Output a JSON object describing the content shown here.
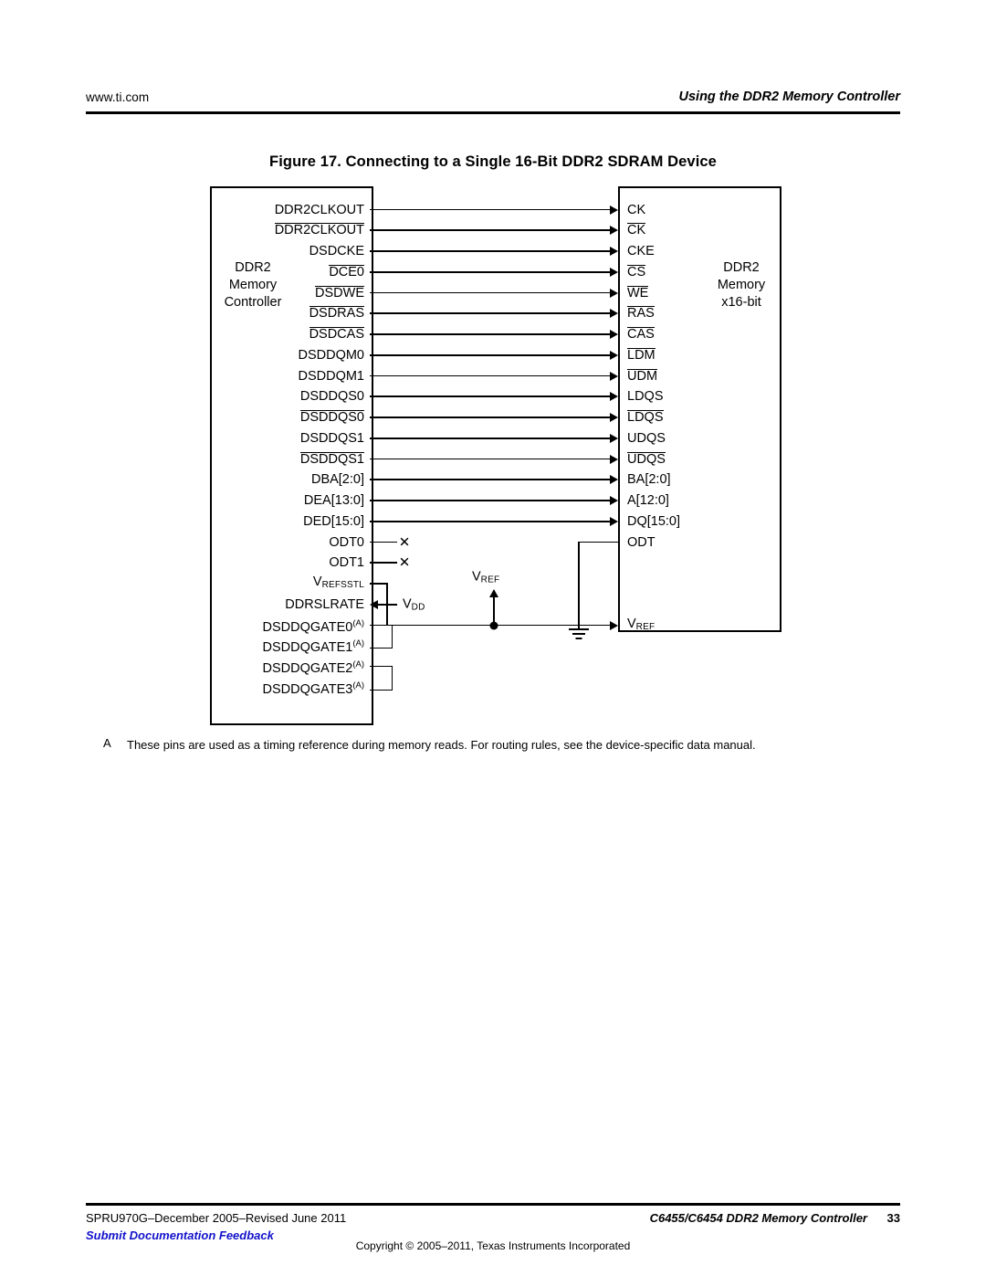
{
  "header": {
    "url": "www.ti.com",
    "section_title": "Using the DDR2 Memory Controller"
  },
  "figure": {
    "caption": "Figure 17. Connecting to a Single 16-Bit DDR2 SDRAM Device",
    "left_block_label": "DDR2\nMemory\nController",
    "left_block_lines": [
      "DDR2",
      "Memory",
      "Controller"
    ],
    "right_block_lines": [
      "DDR2",
      "Memory",
      "x16-bit"
    ],
    "signals": [
      {
        "left": "DDR2CLKOUT",
        "left_overline": false,
        "right": "CK",
        "right_overline": false,
        "arrow": "right"
      },
      {
        "left": "DDR2CLKOUT",
        "left_overline": true,
        "right": "CK",
        "right_overline": true,
        "arrow": "right"
      },
      {
        "left": "DSDCKE",
        "left_overline": false,
        "right": "CKE",
        "right_overline": false,
        "arrow": "right"
      },
      {
        "left": "DCE0",
        "left_overline": true,
        "right": "CS",
        "right_overline": true,
        "arrow": "right"
      },
      {
        "left": "DSDWE",
        "left_overline": true,
        "right": "WE",
        "right_overline": true,
        "arrow": "right"
      },
      {
        "left": "DSDRAS",
        "left_overline": true,
        "right": "RAS",
        "right_overline": true,
        "arrow": "right"
      },
      {
        "left": "DSDCAS",
        "left_overline": true,
        "right": "CAS",
        "right_overline": true,
        "arrow": "right"
      },
      {
        "left": "DSDDQM0",
        "left_overline": false,
        "right": "LDM",
        "right_overline": true,
        "arrow": "right"
      },
      {
        "left": "DSDDQM1",
        "left_overline": false,
        "right": "UDM",
        "right_overline": true,
        "arrow": "right"
      },
      {
        "left": "DSDDQS0",
        "left_overline": false,
        "right": "LDQS",
        "right_overline": false,
        "arrow": "right"
      },
      {
        "left": "DSDDQS0",
        "left_overline": true,
        "right": "LDQS",
        "right_overline": true,
        "arrow": "right"
      },
      {
        "left": "DSDDQS1",
        "left_overline": false,
        "right": "UDQS",
        "right_overline": false,
        "arrow": "right"
      },
      {
        "left": "DSDDQS1",
        "left_overline": true,
        "right": "UDQS",
        "right_overline": true,
        "arrow": "right"
      },
      {
        "left": "DBA[2:0]",
        "left_overline": false,
        "right": "BA[2:0]",
        "right_overline": false,
        "arrow": "right"
      },
      {
        "left": "DEA[13:0]",
        "left_overline": false,
        "right": "A[12:0]",
        "right_overline": false,
        "arrow": "right"
      },
      {
        "left": "DED[15:0]",
        "left_overline": false,
        "right": "DQ[15:0]",
        "right_overline": false,
        "arrow": "right"
      }
    ],
    "odt_pins": [
      {
        "label": "ODT0",
        "terminator": "no-connect"
      },
      {
        "label": "ODT1",
        "terminator": "no-connect"
      }
    ],
    "right_odt_label": "ODT",
    "vref_node_label": "V",
    "vref_node_sub": "REF",
    "vrefsstl_label": "V",
    "vrefsstl_sub": "REFSSTL",
    "right_vref_label": "V",
    "right_vref_sub": "REF",
    "ddrslrate_label": "DDRSLRATE",
    "vdd_label": "V",
    "vdd_sub": "DD",
    "dqgate_pins": [
      {
        "label": "DSDDQGATE0",
        "note": "(A)"
      },
      {
        "label": "DSDDQGATE1",
        "note": "(A)"
      },
      {
        "label": "DSDDQGATE2",
        "note": "(A)"
      },
      {
        "label": "DSDDQGATE3",
        "note": "(A)"
      }
    ]
  },
  "footnote": {
    "mark": "A",
    "text": "These pins are used as a timing reference during memory reads. For routing rules, see the device-specific data manual."
  },
  "footer": {
    "doc_id": "SPRU970G–December 2005–Revised June 2011",
    "feedback": "Submit Documentation Feedback",
    "title": "C6455/C6454 DDR2 Memory Controller",
    "page": "33",
    "copyright": "Copyright © 2005–2011, Texas Instruments Incorporated"
  },
  "colors": {
    "link": "#1111cc",
    "ink": "#000000",
    "page": "#ffffff"
  }
}
